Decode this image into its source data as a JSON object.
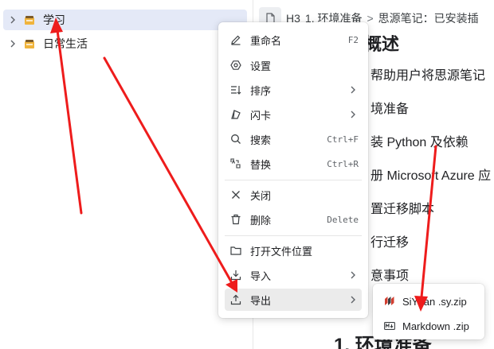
{
  "sidebar": {
    "items": [
      {
        "label": "学习",
        "icon": "notebook-icon",
        "selected": true
      },
      {
        "label": "日常生活",
        "icon": "notebook-icon",
        "selected": false
      }
    ]
  },
  "document": {
    "breadcrumb": {
      "heading_level": "H3",
      "section": "1. 环境准备",
      "separator": ">",
      "doc_title": "思源笔记：已安装插"
    },
    "outline": {
      "heading": "概述",
      "lines": [
        "帮助用户将思源笔记",
        "境准备",
        "装 Python 及依赖",
        "册 Microsoft Azure 应",
        "置迁移脚本",
        "行迁移",
        "意事项"
      ],
      "bottom_heading": "1. 环境准备"
    }
  },
  "context_menu": {
    "items": [
      {
        "label": "重命名",
        "icon": "pencil-icon",
        "shortcut": "F2",
        "submenu": false
      },
      {
        "label": "设置",
        "icon": "settings-icon",
        "shortcut": "",
        "submenu": false
      },
      {
        "label": "排序",
        "icon": "sort-icon",
        "shortcut": "",
        "submenu": true
      },
      {
        "label": "闪卡",
        "icon": "flashcard-icon",
        "shortcut": "",
        "submenu": true
      },
      {
        "label": "搜索",
        "icon": "search-icon",
        "shortcut": "Ctrl+F",
        "submenu": false
      },
      {
        "label": "替换",
        "icon": "replace-icon",
        "shortcut": "Ctrl+R",
        "submenu": false
      },
      {
        "label": "关闭",
        "icon": "close-icon",
        "shortcut": "",
        "submenu": false
      },
      {
        "label": "删除",
        "icon": "trash-icon",
        "shortcut": "Delete",
        "submenu": false
      },
      {
        "label": "打开文件位置",
        "icon": "folder-icon",
        "shortcut": "",
        "submenu": false
      },
      {
        "label": "导入",
        "icon": "import-icon",
        "shortcut": "",
        "submenu": true
      },
      {
        "label": "导出",
        "icon": "export-icon",
        "shortcut": "",
        "submenu": true,
        "active": true
      }
    ]
  },
  "export_submenu": {
    "items": [
      {
        "label": "SiYuan .sy.zip",
        "icon": "siyuan-logo-icon"
      },
      {
        "label": "Markdown .zip",
        "icon": "markdown-icon"
      }
    ]
  },
  "colors": {
    "selection": "#e4e9f7",
    "menu_active": "#ebebeb",
    "annotation_arrow": "#ee1c1c"
  }
}
